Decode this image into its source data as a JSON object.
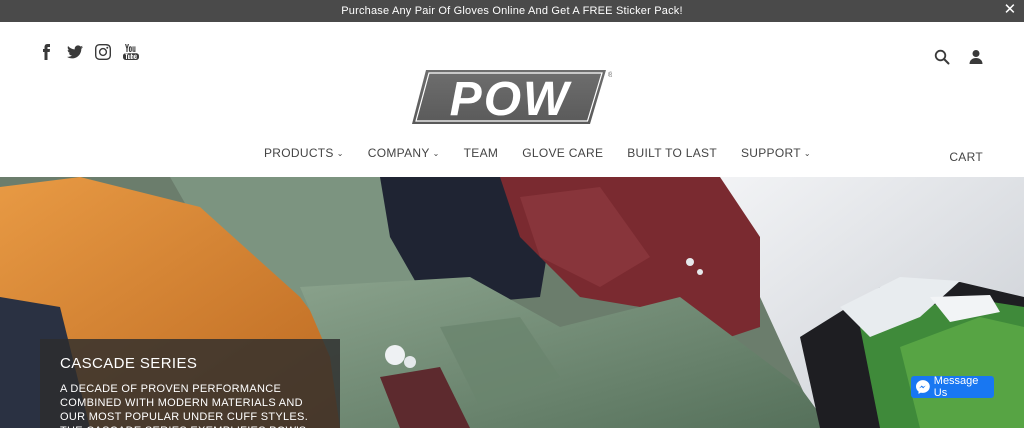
{
  "announcement": {
    "text": "Purchase Any Pair Of Gloves Online And Get A FREE Sticker Pack!",
    "close_glyph": "✕"
  },
  "social_icons": [
    "facebook-icon",
    "twitter-icon",
    "instagram-icon",
    "youtube-icon"
  ],
  "utility_icons": [
    "search-icon",
    "user-account-icon"
  ],
  "logo": {
    "text": "POW",
    "registered_mark": "®"
  },
  "nav": {
    "items": [
      {
        "label": "PRODUCTS",
        "dropdown": true
      },
      {
        "label": "COMPANY",
        "dropdown": true
      },
      {
        "label": "TEAM",
        "dropdown": false
      },
      {
        "label": "GLOVE CARE",
        "dropdown": false
      },
      {
        "label": "BUILT TO LAST",
        "dropdown": false
      },
      {
        "label": "SUPPORT",
        "dropdown": true
      }
    ],
    "cart_label": "CART",
    "caret_glyph": "⌄"
  },
  "hero": {
    "title": "CASCADE SERIES",
    "body": "A DECADE OF PROVEN PERFORMANCE COMBINED WITH MODERN MATERIALS AND OUR MOST POPULAR UNDER CUFF STYLES. THE CASCADE SERIES EXEMPLIFIES POW'S"
  },
  "messenger": {
    "label": "Message Us"
  },
  "colors": {
    "announcement_bg": "#4a4a4a",
    "messenger_blue": "#1877f2",
    "orange_jacket": "#d9822b",
    "maroon_glove": "#7a2a30",
    "green_jacket": "#6f8a72"
  }
}
